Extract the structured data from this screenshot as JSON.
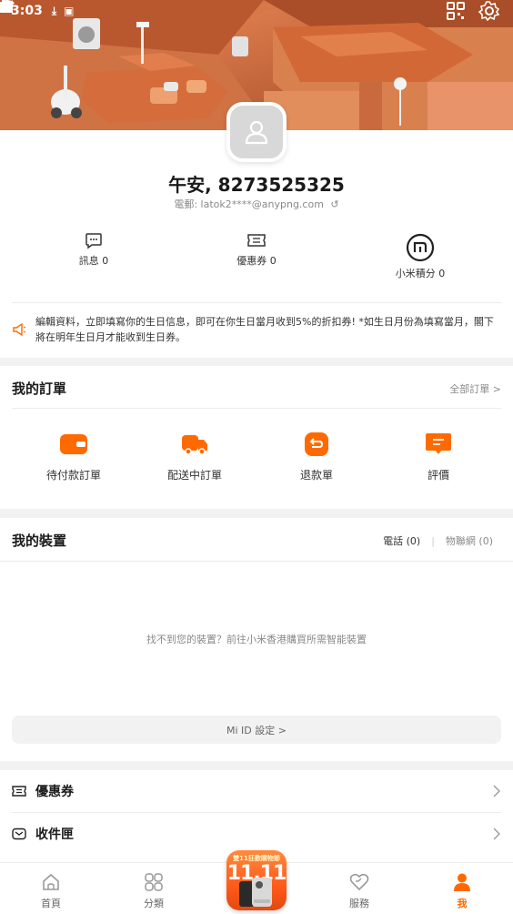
{
  "status_bar": {
    "time": "3:03"
  },
  "profile": {
    "greeting": "午安, 8273525325",
    "email": "電郵: latok2****@anypng.com",
    "stats": [
      {
        "label": "訊息 0"
      },
      {
        "label": "優惠券 0"
      },
      {
        "label": "小米積分 0"
      }
    ],
    "notice": "編輯資料，立即填寫你的生日信息，即可在你生日當月收到5%的折扣券! *如生日月份為填寫當月，閣下將在明年生日月才能收到生日券。"
  },
  "orders": {
    "title": "我的訂單",
    "all_link": "全部訂單 >",
    "items": [
      {
        "label": "待付款訂單"
      },
      {
        "label": "配送中訂單"
      },
      {
        "label": "退款單"
      },
      {
        "label": "評價"
      }
    ]
  },
  "devices": {
    "title": "我的裝置",
    "tab_phone": "電話 (0)",
    "tab_iot": "物聯網 (0)",
    "empty_text": "找不到您的裝置？前往小米香港購買所需智能裝置",
    "miid_button": "Mi ID 設定 >"
  },
  "menu_rows": [
    {
      "label": "優惠券"
    },
    {
      "label": "收件匣"
    }
  ],
  "bottom_nav": {
    "items": [
      {
        "label": "首頁"
      },
      {
        "label": "分類"
      },
      {
        "label": "服務"
      },
      {
        "label": "我"
      }
    ],
    "promo_badge": "雙11狂歡購物節",
    "promo_number": "11.11"
  },
  "colors": {
    "accent": "#ff6a00"
  }
}
